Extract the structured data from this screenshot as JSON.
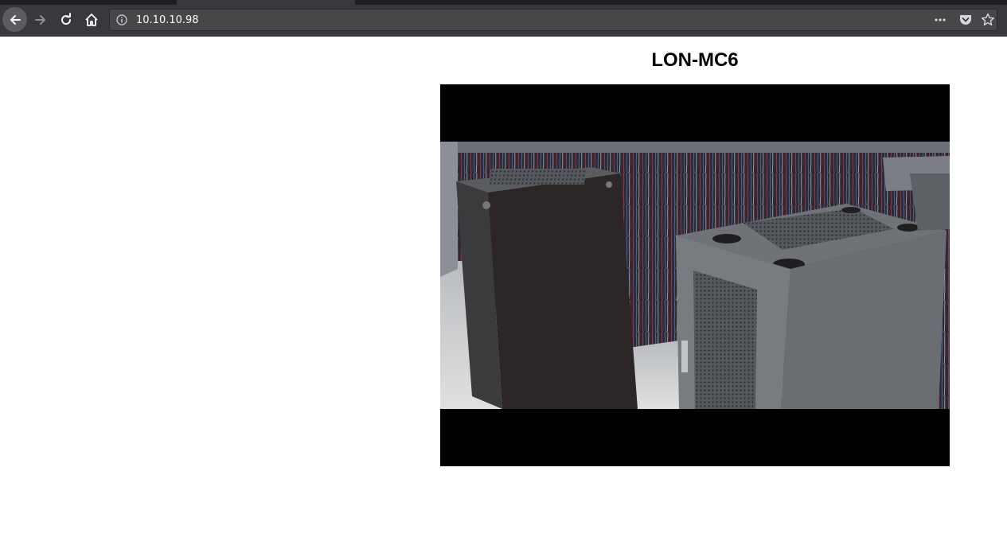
{
  "browser": {
    "url": "10.10.10.98",
    "icons": {
      "back": "back-arrow-icon",
      "forward": "forward-arrow-icon",
      "reload": "reload-icon",
      "home": "home-icon",
      "info": "info-icon",
      "page_actions": "more-horizontal-icon",
      "pocket": "pocket-icon",
      "bookmark": "star-icon"
    },
    "colors": {
      "chrome": "#38383d",
      "urlbar": "#474749",
      "text": "#f9f9fa"
    }
  },
  "page": {
    "title": "LON-MC6",
    "feed": "camera-feed-image"
  }
}
